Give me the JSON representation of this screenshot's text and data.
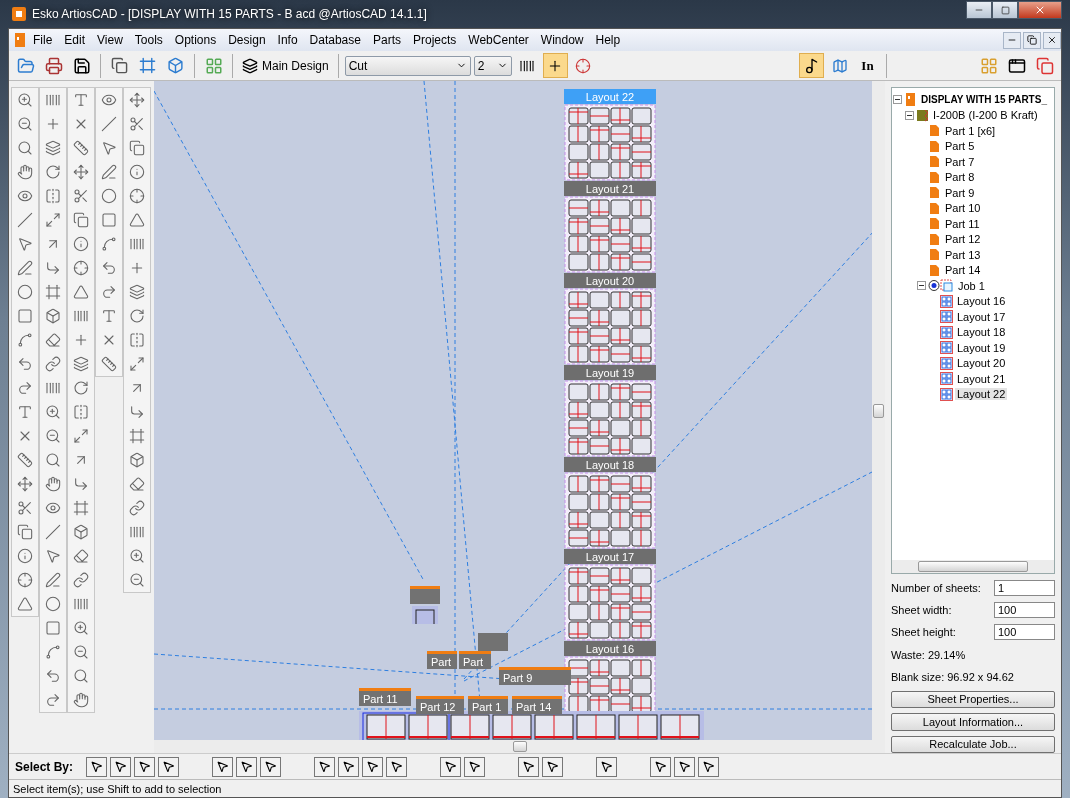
{
  "window": {
    "title": "Esko ArtiosCAD - [DISPLAY WITH 15 PARTS - B acd @ArtiosCAD 14.1.1]"
  },
  "menu": [
    "File",
    "Edit",
    "View",
    "Tools",
    "Options",
    "Design",
    "Info",
    "Database",
    "Parts",
    "Projects",
    "WebCenter",
    "Window",
    "Help"
  ],
  "toolbar": {
    "design_button": "Main Design",
    "line_type": "Cut",
    "pen": "2",
    "units_button": "In"
  },
  "canvas": {
    "layouts": [
      {
        "label": "Layout 22",
        "selected": true
      },
      {
        "label": "Layout 21",
        "selected": false
      },
      {
        "label": "Layout 20",
        "selected": false
      },
      {
        "label": "Layout 19",
        "selected": false
      },
      {
        "label": "Layout 18",
        "selected": false
      },
      {
        "label": "Layout 17",
        "selected": false
      },
      {
        "label": "Layout 16",
        "selected": false
      }
    ],
    "parts": [
      {
        "label": "Part"
      },
      {
        "label": "Part"
      },
      {
        "label": "Part 9"
      },
      {
        "label": "Part 11"
      },
      {
        "label": "Part 12"
      },
      {
        "label": "Part 1"
      },
      {
        "label": "Part 14"
      }
    ]
  },
  "tree": [
    {
      "kind": "design",
      "label": "DISPLAY WITH 15 PARTS_",
      "expanded": true,
      "selected": false,
      "children": [
        {
          "kind": "material",
          "label": "I-200B (I-200 B Kraft)",
          "expanded": true,
          "selected": false,
          "children": [
            {
              "kind": "part",
              "label": "Part 1 [x6]",
              "selected": false
            },
            {
              "kind": "part",
              "label": "Part 5",
              "selected": false
            },
            {
              "kind": "part",
              "label": "Part 7",
              "selected": false
            },
            {
              "kind": "part",
              "label": "Part 8",
              "selected": false
            },
            {
              "kind": "part",
              "label": "Part 9",
              "selected": false
            },
            {
              "kind": "part",
              "label": "Part 10",
              "selected": false
            },
            {
              "kind": "part",
              "label": "Part 11",
              "selected": false
            },
            {
              "kind": "part",
              "label": "Part 12",
              "selected": false
            },
            {
              "kind": "part",
              "label": "Part 13",
              "selected": false
            },
            {
              "kind": "part",
              "label": "Part 14",
              "selected": false
            },
            {
              "kind": "job",
              "label": "Job 1",
              "expanded": true,
              "selected": false,
              "children": [
                {
                  "kind": "layout",
                  "label": "Layout 16",
                  "selected": false
                },
                {
                  "kind": "layout",
                  "label": "Layout 17",
                  "selected": false
                },
                {
                  "kind": "layout",
                  "label": "Layout 18",
                  "selected": false
                },
                {
                  "kind": "layout",
                  "label": "Layout 19",
                  "selected": false
                },
                {
                  "kind": "layout",
                  "label": "Layout 20",
                  "selected": false
                },
                {
                  "kind": "layout",
                  "label": "Layout 21",
                  "selected": false
                },
                {
                  "kind": "layout",
                  "label": "Layout 22",
                  "selected": true
                }
              ]
            }
          ]
        }
      ]
    }
  ],
  "properties": {
    "fields": [
      {
        "label": "Number of sheets:",
        "value": "1"
      },
      {
        "label": "Sheet width:",
        "value": "100"
      },
      {
        "label": "Sheet height:",
        "value": "100"
      }
    ],
    "info": [
      "Waste: 29.14%",
      "Blank size: 96.92 x 94.62"
    ],
    "buttons": [
      "Sheet Properties...",
      "Layout Information...",
      "Recalculate Job..."
    ]
  },
  "select_by": {
    "label": "Select By:"
  },
  "status_bar": "Select item(s); use Shift to add to selection"
}
